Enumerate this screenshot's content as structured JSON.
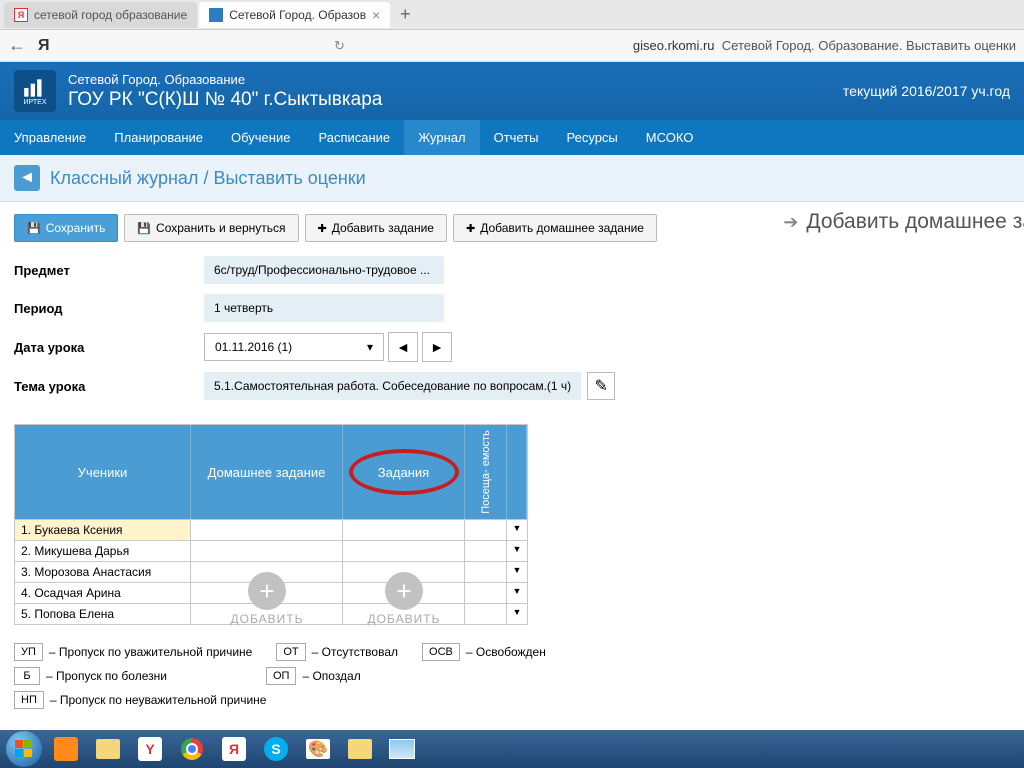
{
  "browser": {
    "tabs": [
      {
        "title": "сетевой город образование",
        "active": false
      },
      {
        "title": "Сетевой Город. Образов",
        "active": true
      }
    ],
    "url_host": "giseo.rkomi.ru",
    "url_title": "Сетевой Город. Образование. Выставить оценки",
    "yandex_letter": "Я"
  },
  "header": {
    "system_name": "Сетевой Город. Образование",
    "school_name": "ГОУ РК \"С(К)Ш № 40\" г.Сыктывкара",
    "year_label": "текущий 2016/2017 уч.год",
    "logo_label": "ИРТЕХ"
  },
  "nav": {
    "items": [
      "Управление",
      "Планирование",
      "Обучение",
      "Расписание",
      "Журнал",
      "Отчеты",
      "Ресурсы",
      "МСОКО"
    ],
    "active": "Журнал"
  },
  "breadcrumb": {
    "section": "Классный журнал",
    "page": "Выставить оценки"
  },
  "toolbar": {
    "save": "Сохранить",
    "save_return": "Сохранить и вернуться",
    "add_task": "Добавить задание",
    "add_homework": "Добавить домашнее задание"
  },
  "side_title": "Добавить домашнее за",
  "form": {
    "subject_label": "Предмет",
    "subject_value": "6с/труд/Профессионально-трудовое ...",
    "period_label": "Период",
    "period_value": "1 четверть",
    "date_label": "Дата урока",
    "date_value": "01.11.2016 (1)",
    "topic_label": "Тема урока",
    "topic_value": "5.1.Самостоятельная работа. Собеседование по вопросам.(1 ч)"
  },
  "grid": {
    "col_students": "Ученики",
    "col_homework": "Домашнее задание",
    "col_tasks": "Задания",
    "col_attendance": "Посеща-\nемость",
    "add_label": "ДОБАВИТЬ",
    "students": [
      "1. Букаева Ксения",
      "2. Микушева Дарья",
      "3. Морозова Анастасия",
      "4. Осадчая Арина",
      "5. Попова Елена"
    ]
  },
  "legend": {
    "items": [
      {
        "code": "УП",
        "text": "– Пропуск по уважительной причине"
      },
      {
        "code": "ОТ",
        "text": "– Отсутствовал"
      },
      {
        "code": "ОСВ",
        "text": "– Освобожден"
      },
      {
        "code": "Б",
        "text": "– Пропуск по болезни"
      },
      {
        "code": "ОП",
        "text": "– Опоздал"
      },
      {
        "code": "НП",
        "text": "– Пропуск по неуважительной причине"
      }
    ]
  }
}
